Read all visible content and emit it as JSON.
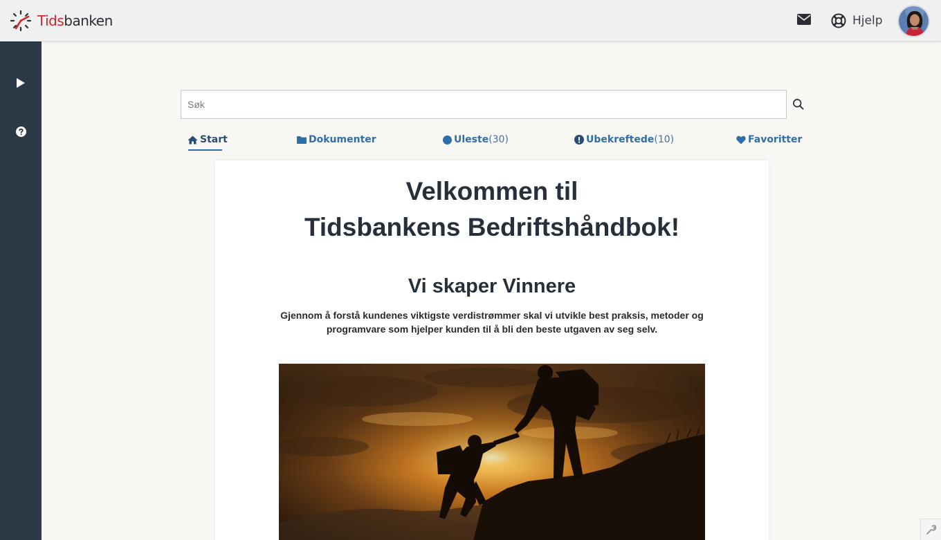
{
  "brand": {
    "name_part1": "Tids",
    "name_part2": "banken",
    "red": "#d5232b"
  },
  "header": {
    "mail_icon": "envelope-icon",
    "help_icon": "lifebuoy-icon",
    "help_label": "Hjelp",
    "avatar": "user-avatar"
  },
  "sidebar": {
    "items": [
      {
        "icon": "play-icon"
      },
      {
        "icon": "question-circle-icon"
      }
    ]
  },
  "search": {
    "placeholder": "Søk",
    "value": ""
  },
  "tabs": [
    {
      "label": "Start",
      "icon": "home-icon",
      "count": "",
      "active": true
    },
    {
      "label": "Dokumenter",
      "icon": "folder-icon",
      "count": ""
    },
    {
      "label": "Uleste",
      "icon": "circle-icon",
      "count": "(30)"
    },
    {
      "label": "Ubekreftede",
      "icon": "exclamation-circle-icon",
      "count": "(10)"
    },
    {
      "label": "Favoritter",
      "icon": "heart-icon",
      "count": ""
    }
  ],
  "content": {
    "title_line1": "Velkommen til",
    "title_line2": "Tidsbankens Bedriftshåndbok!",
    "subtitle": "Vi skaper Vinnere",
    "description": "Gjennom å forstå kundenes viktigste verdistrømmer skal vi utvikle best praksis, metoder og programvare som hjelper kunden til å bli den beste utgaven av seg selv."
  },
  "colors": {
    "sidebar": "#2b3a46",
    "link": "#2f6ea8",
    "page_bg": "#f9f7f3"
  }
}
